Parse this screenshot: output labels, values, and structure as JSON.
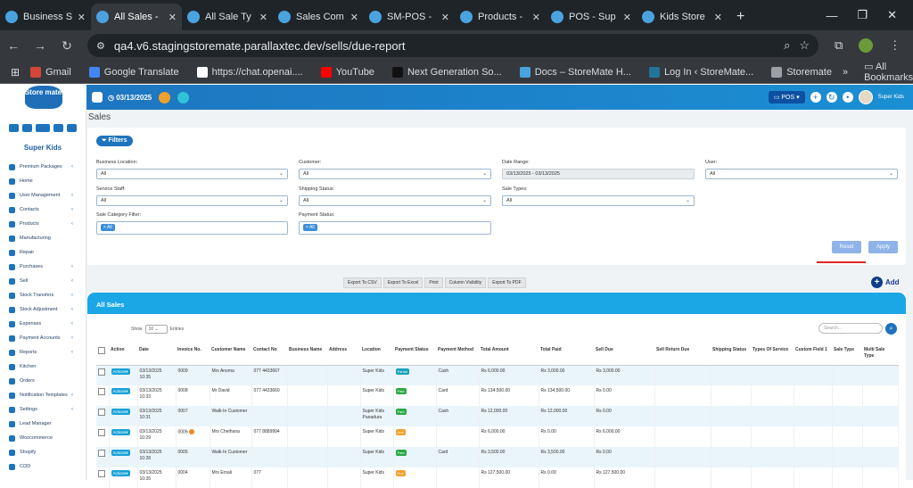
{
  "browser": {
    "tabs": [
      {
        "title": "Business S"
      },
      {
        "title": "All Sales -",
        "active": true
      },
      {
        "title": "All Sale Ty"
      },
      {
        "title": "Sales Com"
      },
      {
        "title": "SM-POS -"
      },
      {
        "title": "Products -"
      },
      {
        "title": "POS - Sup"
      },
      {
        "title": "Kids Store"
      }
    ],
    "url": "qa4.v6.stagingstoremate.parallaxtec.dev/sells/due-report",
    "bookmarks": [
      "Gmail",
      "Google Translate",
      "https://chat.openai....",
      "YouTube",
      "Next Generation So...",
      "Docs – StoreMate H...",
      "Log In ‹ StoreMate...",
      "Storemate"
    ],
    "all_bookmarks": "All Bookmarks",
    "more": "»"
  },
  "topbar": {
    "logo_text": "Store mate",
    "date": "03/13/2025",
    "pos_label": "POS",
    "user": "Super Kids"
  },
  "sidebar": {
    "business_name": "Super Kids",
    "items": [
      {
        "label": "Premium Packages",
        "chev": true
      },
      {
        "label": "Home",
        "chev": false
      },
      {
        "label": "User Management",
        "chev": true
      },
      {
        "label": "Contacts",
        "chev": true
      },
      {
        "label": "Products",
        "chev": true
      },
      {
        "label": "Manufacturing",
        "chev": false
      },
      {
        "label": "Repair",
        "chev": false
      },
      {
        "label": "Purchases",
        "chev": true
      },
      {
        "label": "Sell",
        "chev": true
      },
      {
        "label": "Stock Transfers",
        "chev": true
      },
      {
        "label": "Stock Adjustment",
        "chev": true
      },
      {
        "label": "Expenses",
        "chev": true
      },
      {
        "label": "Payment Accounts",
        "chev": true
      },
      {
        "label": "Reports",
        "chev": true
      },
      {
        "label": "Kitchen",
        "chev": false
      },
      {
        "label": "Orders",
        "chev": false
      },
      {
        "label": "Notification Templates",
        "chev": true
      },
      {
        "label": "Settings",
        "chev": true
      },
      {
        "label": "Lead Manager",
        "chev": false
      },
      {
        "label": "Woocommerce",
        "chev": false
      },
      {
        "label": "Shopify",
        "chev": false
      },
      {
        "label": "COD",
        "chev": false
      }
    ]
  },
  "page": {
    "title": "Sales",
    "filters_label": "Filters",
    "business_location": {
      "label": "Business Location:",
      "value": "All"
    },
    "customer": {
      "label": "Customer:",
      "value": "All"
    },
    "date_range": {
      "label": "Date Range:",
      "value": "03/13/2025 - 03/13/2025"
    },
    "user": {
      "label": "User:",
      "value": "All"
    },
    "service_staff": {
      "label": "Service Staff:",
      "value": "All"
    },
    "shipping_status": {
      "label": "Shipping Status:",
      "value": "All"
    },
    "sale_types": {
      "label": "Sale Types:",
      "value": "All"
    },
    "sale_category": {
      "label": "Sale Category Filter:",
      "value": "× All"
    },
    "payment_status": {
      "label": "Payment Status:",
      "value": "× All"
    },
    "reset": "Reset",
    "apply": "Apply",
    "export": [
      "Export To CSV",
      "Export To Excel",
      "Print",
      "Column Visibility",
      "Export To PDF"
    ],
    "add": "Add"
  },
  "sales": {
    "heading": "All Sales",
    "show_label": "Show",
    "show_value": "10",
    "entries_label": "Entries",
    "search_placeholder": "Search...",
    "columns": [
      "",
      "Action",
      "Date",
      "Invoice No.",
      "Customer Name",
      "Contact No",
      "Business Name",
      "Address",
      "Location",
      "Payment Status",
      "Payment Method",
      "Total Amount",
      "Total Paid",
      "Sell Due",
      "Sell Return Due",
      "Shipping Status",
      "Types Of Service",
      "Custom Field 1",
      "Sale Type",
      "Multi Sale Type"
    ],
    "rows": [
      {
        "action": "Actions",
        "date": "03/13/2025 10:35",
        "invoice": "0009",
        "customer": "Mrs Anoma",
        "contact": "077 4433667",
        "business": "",
        "address": "",
        "location": "Super Kids",
        "status": "Partial",
        "status_type": "partial",
        "method": "Cash",
        "total": "Rs 6,000.00",
        "paid": "Rs 3,000.00",
        "due": "Rs 3,000.00",
        "return_due": "",
        "shipping": "",
        "service": "",
        "custom": "",
        "sale_type": "",
        "multi": "",
        "dot": false
      },
      {
        "action": "Actions",
        "date": "03/13/2025 10:33",
        "invoice": "0008",
        "customer": "Mr David",
        "contact": "077 4433660",
        "business": "",
        "address": "",
        "location": "Super Kids",
        "status": "Paid",
        "status_type": "paid",
        "method": "Card",
        "total": "Rs 134,500.00",
        "paid": "Rs 134,500.00",
        "due": "Rs 0.00",
        "return_due": "",
        "shipping": "",
        "service": "",
        "custom": "",
        "sale_type": "",
        "multi": "",
        "dot": false
      },
      {
        "action": "Actions",
        "date": "03/13/2025 10:31",
        "invoice": "0007",
        "customer": "Walk-In Customer",
        "contact": "",
        "business": "",
        "address": "",
        "location": "Super Kids Panadura",
        "status": "Paid",
        "status_type": "paid",
        "method": "Cash",
        "total": "Rs 12,000.00",
        "paid": "Rs 12,000.00",
        "due": "Rs 0.00",
        "return_due": "",
        "shipping": "",
        "service": "",
        "custom": "",
        "sale_type": "",
        "multi": "",
        "dot": false
      },
      {
        "action": "Actions",
        "date": "03/13/2025 10:29",
        "invoice": "0006",
        "customer": "Mrs Chethana",
        "contact": "077 8889994",
        "business": "",
        "address": "",
        "location": "Super Kids",
        "status": "Due",
        "status_type": "due",
        "method": "",
        "total": "Rs 6,000.00",
        "paid": "Rs 0.00",
        "due": "Rs 6,000.00",
        "return_due": "",
        "shipping": "",
        "service": "",
        "custom": "",
        "sale_type": "",
        "multi": "",
        "dot": true
      },
      {
        "action": "Actions",
        "date": "03/13/2025 10:28",
        "invoice": "0005",
        "customer": "Walk-In Customer",
        "contact": "",
        "business": "",
        "address": "",
        "location": "Super Kids",
        "status": "Paid",
        "status_type": "paid",
        "method": "Card",
        "total": "Rs 3,500.00",
        "paid": "Rs 3,500.00",
        "due": "Rs 0.00",
        "return_due": "",
        "shipping": "",
        "service": "",
        "custom": "",
        "sale_type": "",
        "multi": "",
        "dot": false
      },
      {
        "action": "Actions",
        "date": "03/13/2025 10:26",
        "invoice": "0004",
        "customer": "Mrs Ernali",
        "contact": "077",
        "business": "",
        "address": "",
        "location": "Super Kids",
        "status": "Due",
        "status_type": "due",
        "method": "",
        "total": "Rs 127,500.00",
        "paid": "Rs 0.00",
        "due": "Rs 127,500.00",
        "return_due": "",
        "shipping": "",
        "service": "",
        "custom": "",
        "sale_type": "",
        "multi": "",
        "dot": false
      }
    ]
  },
  "colors": {
    "primary": "#1e73be",
    "header_bar": "#1ba7e6",
    "accent_red": "#e02424"
  }
}
